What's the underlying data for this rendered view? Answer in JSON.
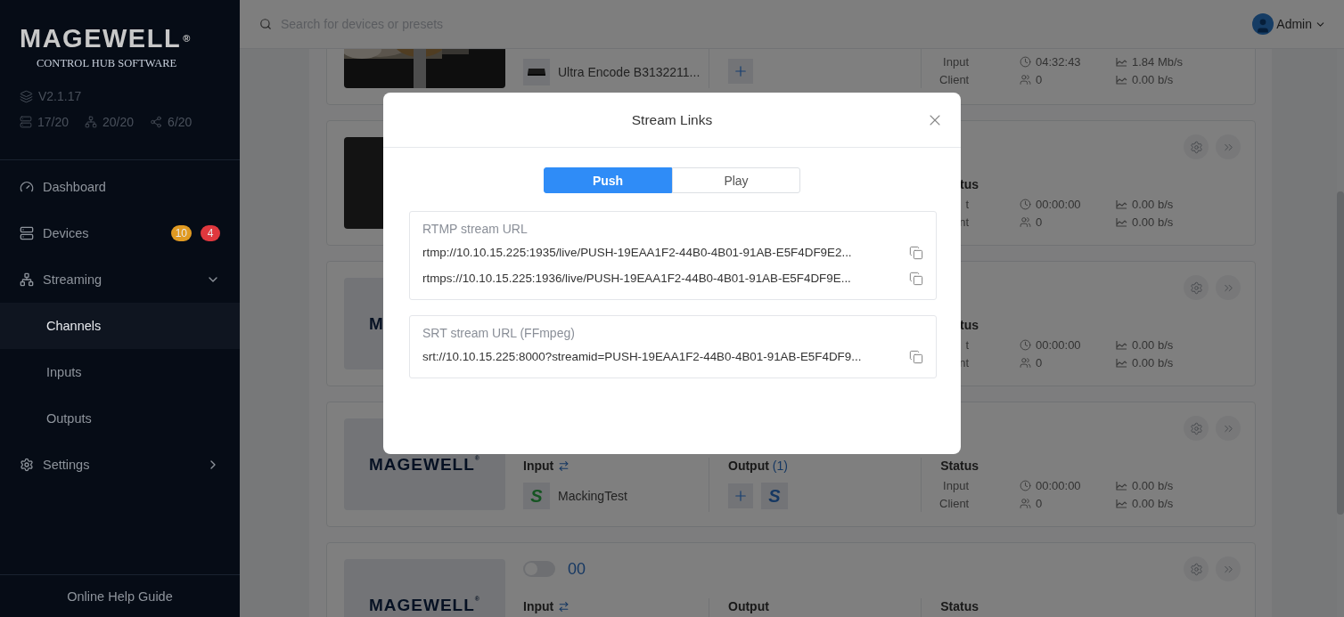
{
  "sidebar": {
    "logo": "MAGEWELL",
    "logo_mark": "®",
    "subtitle": "CONTROL HUB SOFTWARE",
    "version": "V2.1.17",
    "stats": [
      {
        "kind": "devices",
        "value": "17/20"
      },
      {
        "kind": "streams",
        "value": "20/20"
      },
      {
        "kind": "shares",
        "value": "6/20"
      }
    ],
    "nav": [
      {
        "kind": "dashboard",
        "label": "Dashboard",
        "selected": false
      },
      {
        "kind": "devices",
        "label": "Devices",
        "selected": false,
        "badges": [
          {
            "text": "10",
            "color": "#e09a22"
          },
          {
            "text": "4",
            "color": "#e0383e"
          }
        ]
      },
      {
        "kind": "streaming",
        "label": "Streaming",
        "selected": false,
        "expanded": true,
        "children": [
          {
            "label": "Channels",
            "selected": true
          },
          {
            "label": "Inputs",
            "selected": false
          },
          {
            "label": "Outputs",
            "selected": false
          }
        ]
      },
      {
        "kind": "settings",
        "label": "Settings",
        "selected": false,
        "expanded": false
      }
    ],
    "help_link": "Online Help Guide"
  },
  "header": {
    "search": {
      "placeholder": "Search for devices or presets"
    },
    "user": "Admin"
  },
  "channels": [
    {
      "input": {
        "source": {
          "kind": "device",
          "name": "Ultra Encode B3132211..."
        }
      },
      "output": {
        "items": [
          {
            "kind": "add"
          }
        ]
      },
      "status": {
        "rows": [
          {
            "kind": "input",
            "label": "Input",
            "value": "04:32:43",
            "rate": "1.84 Mb/s"
          },
          {
            "kind": "client",
            "label": "Client",
            "value": "0",
            "rate": "0.00 b/s"
          }
        ]
      }
    },
    {
      "thumbnail": {
        "kind": "dark"
      },
      "header_actions": true,
      "status": {
        "label": "tus",
        "rows": [
          {
            "kind": "input",
            "label": "t",
            "value": "00:00:00",
            "rate": "0.00 b/s"
          },
          {
            "kind": "client",
            "label": "nt",
            "value": "0",
            "rate": "0.00 b/s"
          }
        ]
      }
    },
    {
      "thumbnail": {
        "kind": "logo",
        "text": "M"
      },
      "header_actions": true,
      "status": {
        "label": "tus",
        "rows": [
          {
            "kind": "input",
            "label": "t",
            "value": "00:00:00",
            "rate": "0.00 b/s"
          },
          {
            "kind": "client",
            "label": "nt",
            "value": "0",
            "rate": "0.00 b/s"
          }
        ]
      }
    },
    {
      "thumbnail": {
        "kind": "logo",
        "text": "MAGEWELL",
        "mark": "®"
      },
      "header_actions": true,
      "input": {
        "label": "Input",
        "source": {
          "kind": "srt",
          "badge": "S",
          "name": "MackingTest"
        }
      },
      "output": {
        "label": "Output",
        "count": "(1)",
        "items": [
          {
            "kind": "add"
          },
          {
            "kind": "srt",
            "badge": "S"
          }
        ]
      },
      "status": {
        "label": "Status",
        "rows": [
          {
            "kind": "input",
            "label": "Input",
            "value": "00:00:00",
            "rate": "0.00 b/s"
          },
          {
            "kind": "client",
            "label": "Client",
            "value": "0",
            "rate": "0.00 b/s"
          }
        ]
      }
    },
    {
      "thumbnail": {
        "kind": "logo",
        "text": "MAGEWELL",
        "mark": "®"
      },
      "header_actions": true,
      "toggle": {
        "on": false
      },
      "name": "00",
      "input": {
        "label": "Input"
      },
      "output": {
        "label": "Output"
      },
      "status": {
        "label": "Status"
      }
    }
  ],
  "modal": {
    "title": "Stream Links",
    "tabs": [
      {
        "label": "Push",
        "selected": true
      },
      {
        "label": "Play",
        "selected": false
      }
    ],
    "groups": [
      {
        "title": "RTMP stream URL",
        "urls": [
          "rtmp://10.10.15.225:1935/live/PUSH-19EAA1F2-44B0-4B01-91AB-E5F4DF9E2...",
          "rtmps://10.10.15.225:1936/live/PUSH-19EAA1F2-44B0-4B01-91AB-E5F4DF9E..."
        ]
      },
      {
        "title": "SRT stream URL (FFmpeg)",
        "urls": [
          "srt://10.10.15.225:8000?streamid=PUSH-19EAA1F2-44B0-4B01-91AB-E5F4DF9..."
        ]
      }
    ]
  }
}
